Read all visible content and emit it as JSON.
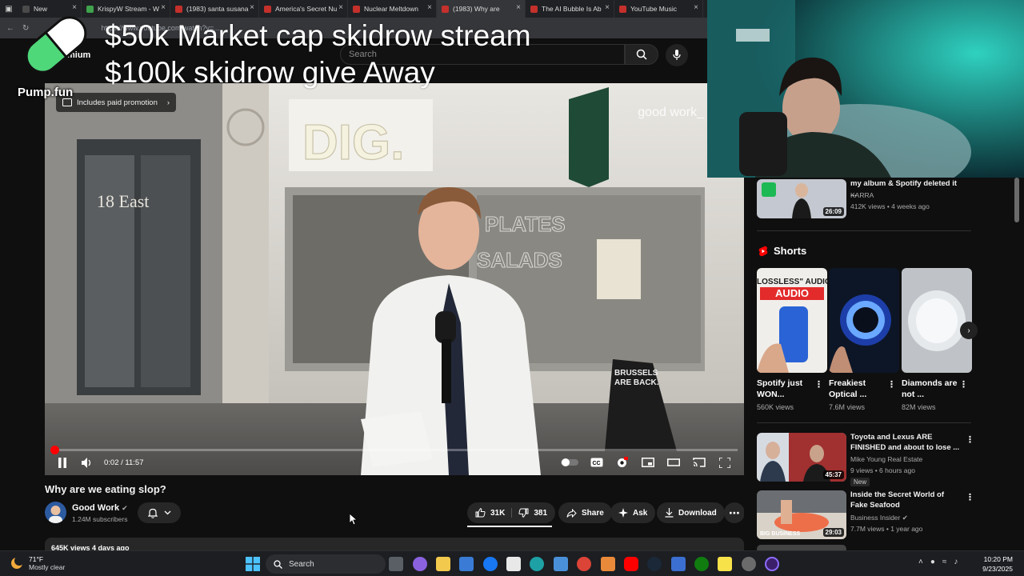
{
  "browser": {
    "tabs": [
      {
        "label": "New",
        "fav": "#4a4a4a"
      },
      {
        "label": "KrispyW Stream - W",
        "fav": "#3fa34d"
      },
      {
        "label": "(1983) santa susana",
        "fav": "#c4302b"
      },
      {
        "label": "America's Secret Nu",
        "fav": "#c4302b"
      },
      {
        "label": "Nuclear Meltdown",
        "fav": "#c4302b"
      },
      {
        "label": "(1983) Why are",
        "fav": "#c4302b"
      },
      {
        "label": "The AI Bubble Is Ab",
        "fav": "#c4302b"
      },
      {
        "label": "YouTube Music",
        "fav": "#c4302b"
      }
    ],
    "url": "https://www.youtube.com/watch?v=...",
    "logo": "mium"
  },
  "overlay": {
    "line1": "$50k Market cap skidrow stream",
    "line2": "$100k skidrow give Away",
    "brand": "Pump.fun"
  },
  "youtube": {
    "search_placeholder": "Search"
  },
  "video": {
    "promo_label": "Includes paid promotion",
    "watermark": "good work_",
    "time": "0:02 / 11:57",
    "progress_fraction": 0.003,
    "title": "Why are we eating slop?",
    "channel": "Good Work",
    "subscribers": "1.24M subscribers",
    "likes": "31K",
    "dislikes": "381",
    "share": "Share",
    "ask": "Ask",
    "download": "Download",
    "views_date": "645K views  4 days ago"
  },
  "sidebar": {
    "top_item": {
      "title": "my album & Spotify deleted it ...",
      "channel": "KARRA",
      "meta": "412K views • 4 weeks ago",
      "duration": "26:09"
    },
    "shorts_label": "Shorts",
    "shorts": [
      {
        "title": "Spotify just WON...",
        "views": "560K views",
        "thumb_text": "\"LOSSLESS\" AUDIO"
      },
      {
        "title": "Freakiest Optical ...",
        "views": "7.6M views"
      },
      {
        "title": "Diamonds are not ...",
        "views": "82M views"
      }
    ],
    "videos": [
      {
        "title": "Toyota and Lexus ARE FINISHED and about to lose ...",
        "channel": "Mike Young Real Estate",
        "meta": "9 views • 6 hours ago",
        "badge": "New",
        "duration": "45:37"
      },
      {
        "title": "Inside the Secret World of Fake Seafood",
        "channel": "Business Insider",
        "meta": "7.7M views • 1 year ago",
        "duration": "29:03",
        "thumb_text": "BIG BUSINESS"
      }
    ]
  },
  "taskbar": {
    "temp": "71°F",
    "weather": "Mostly clear",
    "search": "Search",
    "time": "10:20 PM",
    "date": "9/23/2025"
  },
  "colors": {
    "accent_red": "#ff0000",
    "bg": "#0f0f0f",
    "chip": "#272727"
  }
}
